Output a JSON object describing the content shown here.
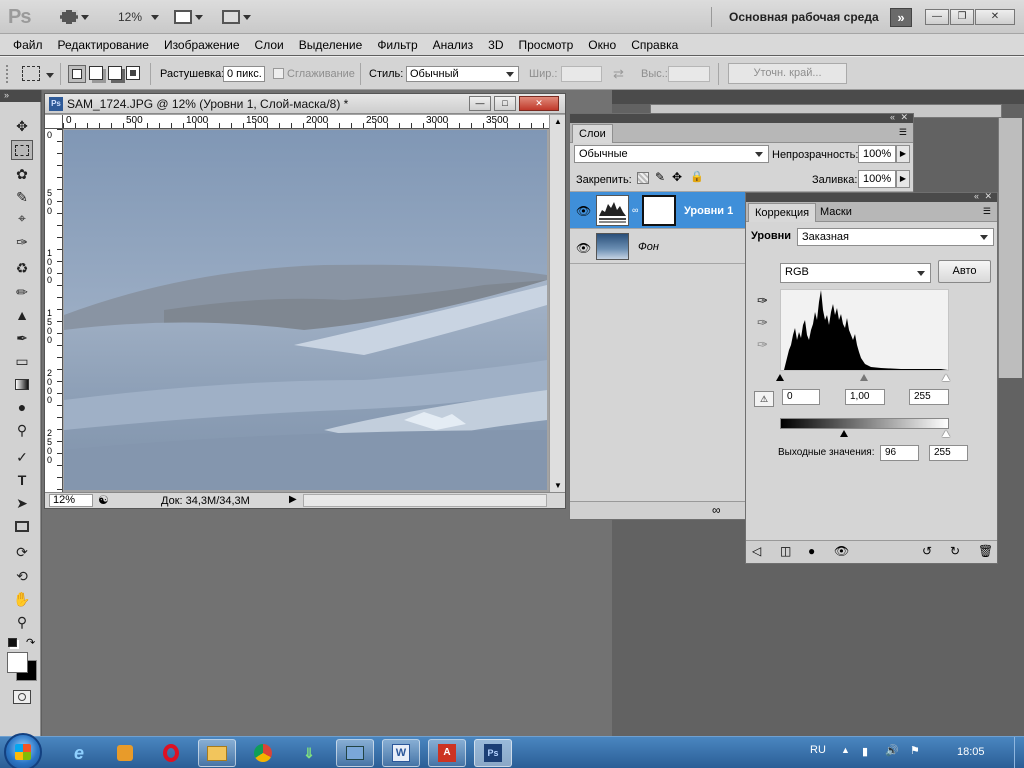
{
  "app": {
    "logo": "Ps",
    "zoom": "12%",
    "workspace": "Основная рабочая среда",
    "workspace_more": "»"
  },
  "menu": [
    "Файл",
    "Редактирование",
    "Изображение",
    "Слои",
    "Выделение",
    "Фильтр",
    "Анализ",
    "3D",
    "Просмотр",
    "Окно",
    "Справка"
  ],
  "options": {
    "feather_label": "Растушевка:",
    "feather_value": "0 пикс.",
    "antialias_label": "Сглаживание",
    "style_label": "Стиль:",
    "style_value": "Обычный",
    "width_label": "Шир.:",
    "height_label": "Выс.:",
    "refine_edge": "Уточн. край..."
  },
  "document": {
    "title": "SAM_1724.JPG @ 12% (Уровни 1, Слой-маска/8) *",
    "ruler_h": [
      "0",
      "500",
      "1000",
      "1500",
      "2000",
      "2500",
      "3000",
      "3500"
    ],
    "ruler_v": [
      "0",
      "500",
      "1000",
      "1500",
      "2000",
      "2500"
    ],
    "zoom_status": "12%",
    "doc_size": "Док: 34,3M/34,3M"
  },
  "layers_panel": {
    "tab": "Слои",
    "blend_mode": "Обычные",
    "opacity_label": "Непрозрачность:",
    "opacity_value": "100%",
    "lock_label": "Закрепить:",
    "fill_label": "Заливка:",
    "fill_value": "100%",
    "layers": [
      {
        "name": "Уровни 1",
        "selected": true
      },
      {
        "name": "Фон",
        "selected": false
      }
    ]
  },
  "adjustments_panel": {
    "tabs": [
      "Коррекция",
      "Маски"
    ],
    "levels_label": "Уровни",
    "preset_value": "Заказная",
    "channel": "RGB",
    "auto_button": "Авто",
    "input_black": "0",
    "input_gamma": "1,00",
    "input_white": "255",
    "output_label": "Выходные значения:",
    "output_black": "96",
    "output_white": "255"
  },
  "taskbar": {
    "language": "RU",
    "time": "18:05"
  }
}
